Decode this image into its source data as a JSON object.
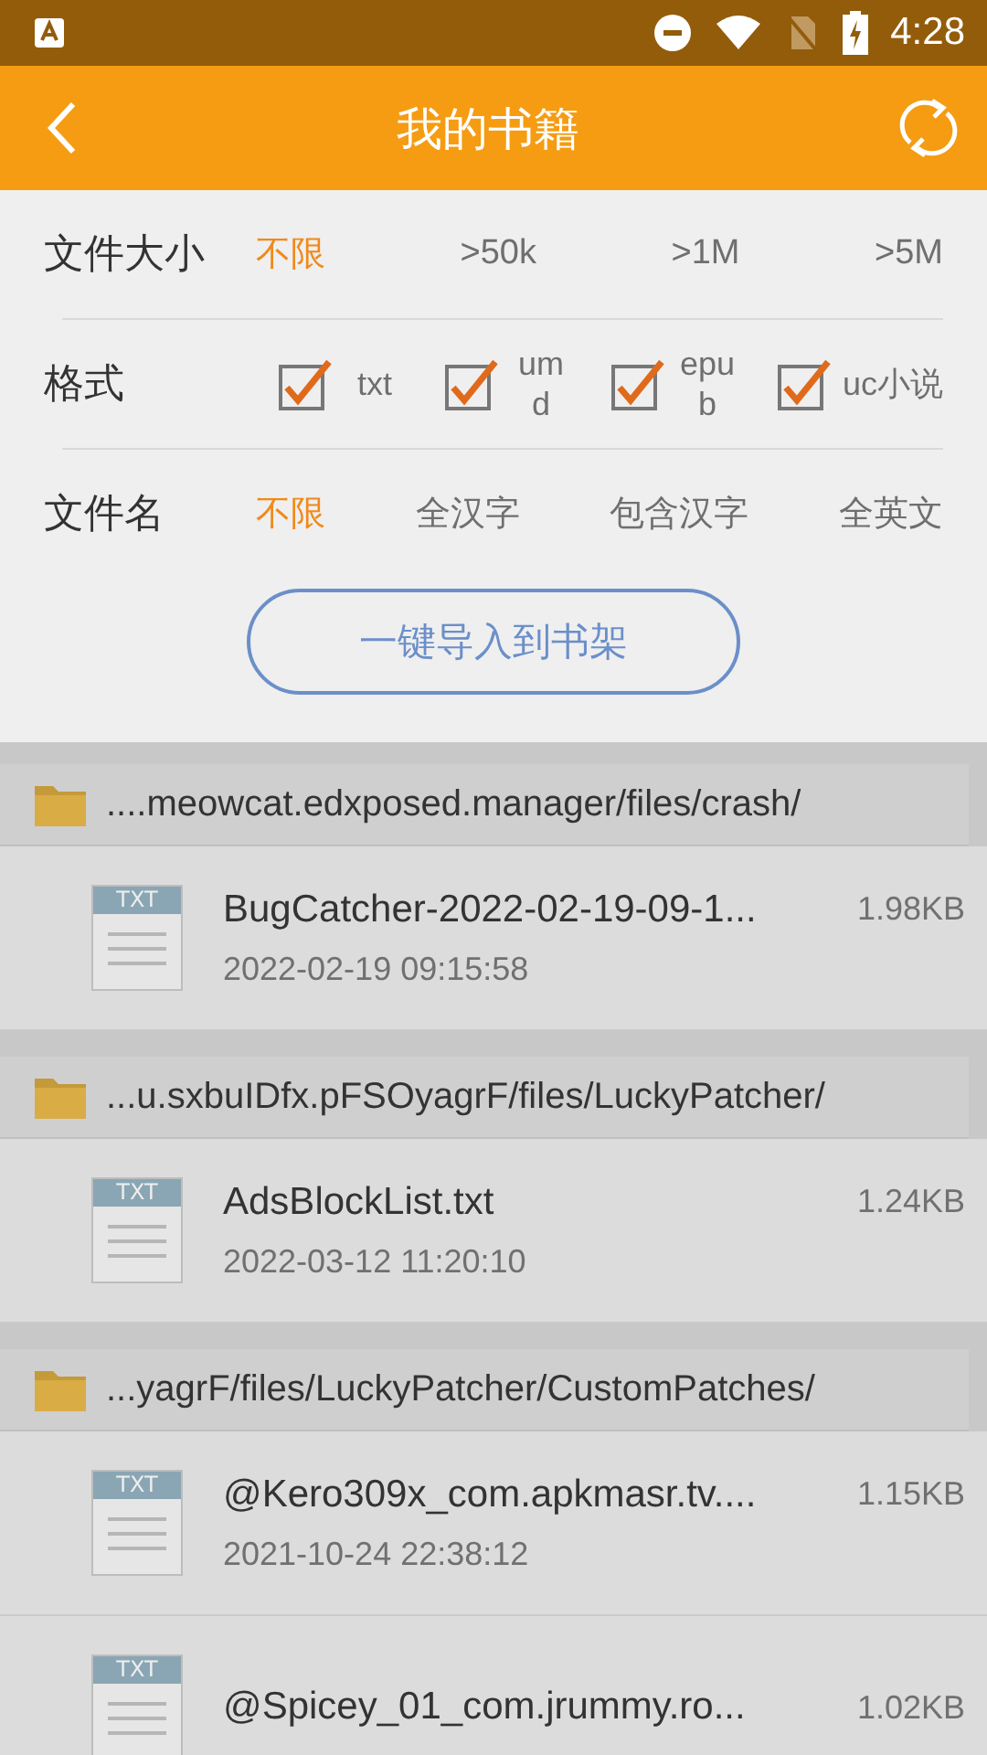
{
  "status_bar": {
    "time": "4:28"
  },
  "header": {
    "title": "我的书籍"
  },
  "filter_panel": {
    "size": {
      "label": "文件大小",
      "options": [
        {
          "label": "不限",
          "selected": true
        },
        {
          "label": ">50k",
          "selected": false
        },
        {
          "label": ">1M",
          "selected": false
        },
        {
          "label": ">5M",
          "selected": false
        }
      ]
    },
    "format": {
      "label": "格式",
      "options": [
        {
          "label": "txt",
          "checked": true
        },
        {
          "label": "um d",
          "checked": true
        },
        {
          "label": "epu b",
          "checked": true
        },
        {
          "label": "uc小说",
          "checked": true
        }
      ]
    },
    "name": {
      "label": "文件名",
      "options": [
        {
          "label": "不限",
          "selected": true
        },
        {
          "label": "全汉字",
          "selected": false
        },
        {
          "label": "包含汉字",
          "selected": false
        },
        {
          "label": "全英文",
          "selected": false
        }
      ]
    },
    "import_button": "一键导入到书架"
  },
  "folders": [
    {
      "path": "....meowcat.edxposed.manager/files/crash/",
      "files": [
        {
          "badge": "TXT",
          "name": "BugCatcher-2022-02-19-09-1...",
          "size": "1.98KB",
          "date": "2022-02-19 09:15:58"
        }
      ]
    },
    {
      "path": "...u.sxbuIDfx.pFSOyagrF/files/LuckyPatcher/",
      "files": [
        {
          "badge": "TXT",
          "name": "AdsBlockList.txt",
          "size": "1.24KB",
          "date": "2022-03-12 11:20:10"
        }
      ]
    },
    {
      "path": "...yagrF/files/LuckyPatcher/CustomPatches/",
      "files": [
        {
          "badge": "TXT",
          "name": "@Kero309x_com.apkmasr.tv....",
          "size": "1.15KB",
          "date": "2021-10-24 22:38:12"
        },
        {
          "badge": "TXT",
          "name": "@Spicey_01_com.jrummy.ro...",
          "size": "1.02KB"
        }
      ]
    }
  ]
}
